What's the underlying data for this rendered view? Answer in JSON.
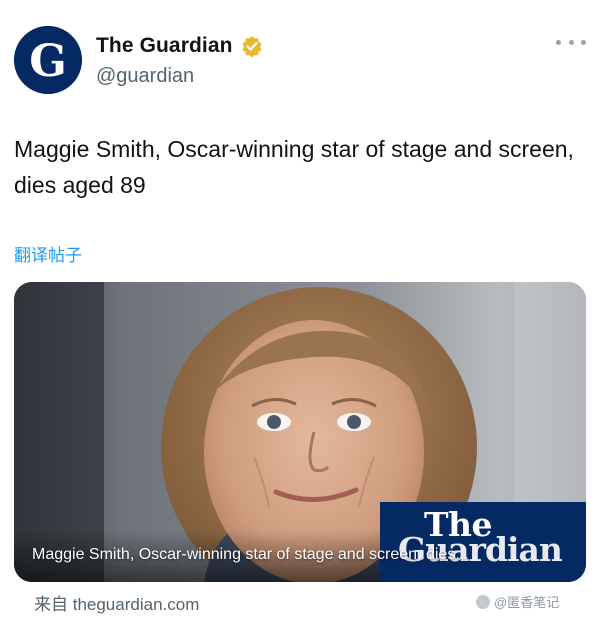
{
  "account": {
    "name": "The Guardian",
    "handle": "@guardian",
    "avatar_icon": "guardian-g-logo",
    "verified_icon": "verified-gold-badge"
  },
  "tweet": {
    "text": "Maggie Smith, Oscar-winning star of stage and screen, dies aged 89",
    "translate_label": "翻译帖子"
  },
  "card": {
    "image": "portrait-photo",
    "caption": "Maggie Smith, Oscar-winning star of stage and screen, dies...",
    "logo_top": "The",
    "logo_bottom": "Guardian"
  },
  "source_label": "来自 theguardian.com",
  "watermark_text": "@匿香笔记",
  "colors": {
    "guardian_blue": "#052962",
    "link_blue": "#1d9bf0",
    "verified_gold": "#e8b82e"
  }
}
